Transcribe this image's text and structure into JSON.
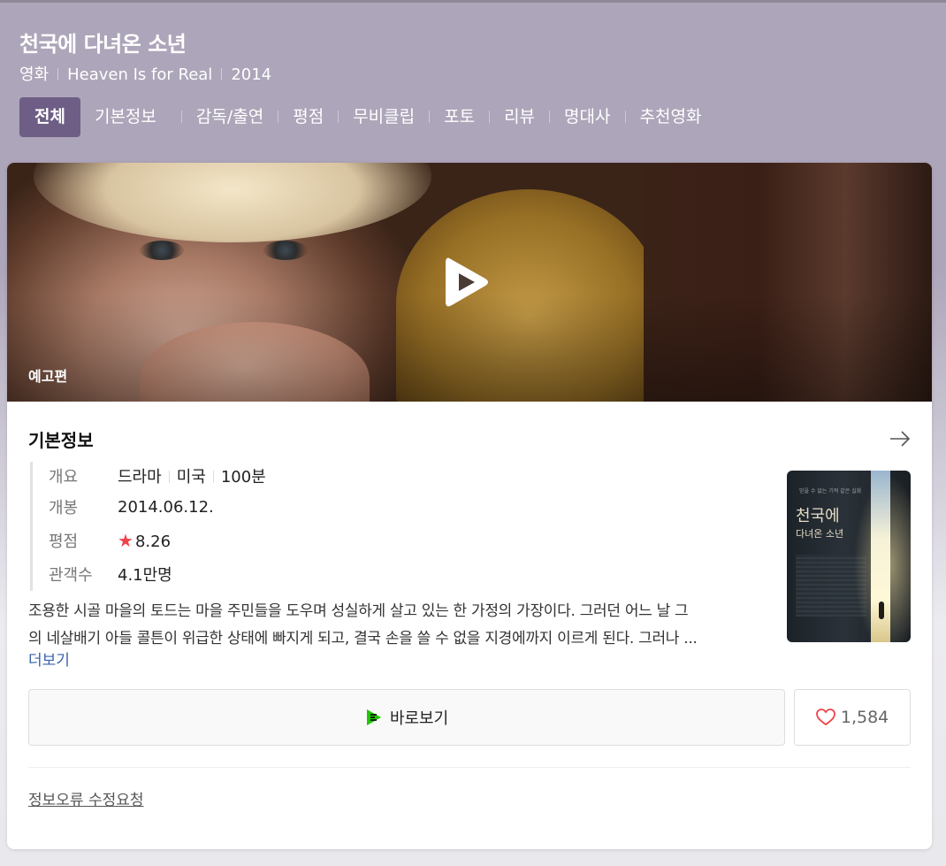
{
  "header": {
    "title": "천국에 다녀온 소년",
    "meta": [
      "영화",
      "Heaven Is for Real",
      "2014"
    ]
  },
  "tabs": [
    {
      "label": "전체",
      "active": true
    },
    {
      "label": "기본정보",
      "active": false
    },
    {
      "label": "감독/출연",
      "active": false
    },
    {
      "label": "평점",
      "active": false
    },
    {
      "label": "무비클립",
      "active": false
    },
    {
      "label": "포토",
      "active": false
    },
    {
      "label": "리뷰",
      "active": false
    },
    {
      "label": "명대사",
      "active": false
    },
    {
      "label": "추천영화",
      "active": false
    }
  ],
  "trailer": {
    "label": "예고편",
    "play_icon": "play-icon"
  },
  "basic_info": {
    "title": "기본정보",
    "rows": {
      "summary_label": "개요",
      "summary_genre": "드라마",
      "summary_country": "미국",
      "summary_runtime": "100분",
      "release_label": "개봉",
      "release_value": "2014.06.12.",
      "rating_label": "평점",
      "rating_value": "8.26",
      "audience_label": "관객수",
      "audience_value": "4.1만명"
    },
    "synopsis_line1": "조용한 시골 마을의 토드는 마을 주민들을 도우며 성실하게 살고 있는 한 가정의 가장이다. 그러던 어느 날 그",
    "synopsis_line2": "의 네살배기 아들 콜튼이 위급한 상태에 빠지게 되고, 결국 손을 쓸 수 없을 지경에까지 이르게 된다. 그러나 ...",
    "more_label": "더보기",
    "poster": {
      "title_line1": "천국에",
      "title_line2": "다녀온 소년",
      "tagline": "믿을 수 없는 기적 같은 실화"
    }
  },
  "actions": {
    "watch_label": "바로보기",
    "like_count": "1,584"
  },
  "footer": {
    "report_label": "정보오류 수정요청"
  },
  "colors": {
    "header_bg": "#ada5b9",
    "active_tab": "#6e5e85",
    "rating_star": "#f0424a",
    "link": "#3a62a8"
  }
}
